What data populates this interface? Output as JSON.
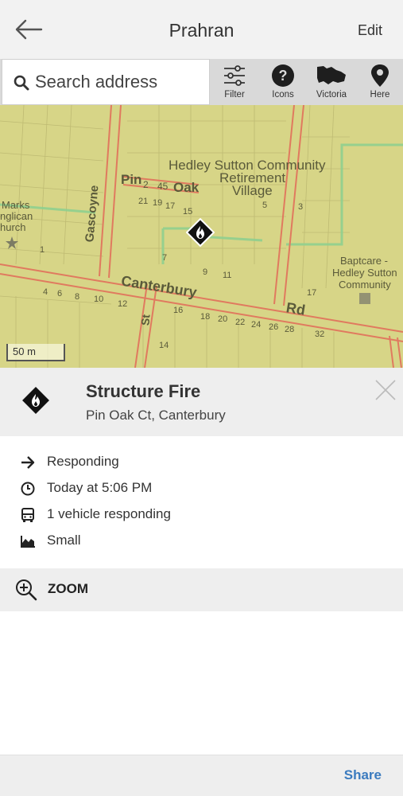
{
  "header": {
    "title": "Prahran",
    "edit_label": "Edit"
  },
  "search": {
    "placeholder": "Search address"
  },
  "toolbar": {
    "filter_label": "Filter",
    "icons_label": "Icons",
    "victoria_label": "Victoria",
    "here_label": "Here"
  },
  "map": {
    "labels": {
      "community": "Hedley Sutton Community",
      "retirement": "Retirement",
      "village": "Village",
      "pin": "Pin",
      "oak": "Oak",
      "gascoyne": "Gascoyne",
      "canterbury": "Canterbury",
      "rd": "Rd",
      "st": "St",
      "marks": "Marks",
      "anglican": "nglican",
      "church": "hurch",
      "baptcare": "Baptcare -",
      "hedley": "Hedley Sutton",
      "community2": "Community",
      "n2": "2",
      "n45": "45",
      "n21": "21",
      "n19": "19",
      "n17": "17",
      "n15": "15",
      "n9": "9",
      "n11": "11",
      "n16": "16",
      "n18": "18",
      "n20": "20",
      "n22": "22",
      "n24": "24",
      "n26": "26",
      "n28": "28",
      "n32": "32",
      "n4": "4",
      "n6": "6",
      "n8": "8",
      "n10": "10",
      "n12": "12",
      "n14": "14",
      "n1": "1",
      "n7": "7",
      "n3": "3",
      "n5": "5",
      "n17b": "17"
    },
    "scale_label": "50 m"
  },
  "incident": {
    "title": "Structure Fire",
    "location": "Pin Oak Ct, Canterbury"
  },
  "details": {
    "status": "Responding",
    "time": "Today at 5:06 PM",
    "vehicles": "1 vehicle responding",
    "size": "Small"
  },
  "zoom": {
    "label": "ZOOM"
  },
  "footer": {
    "share_label": "Share"
  },
  "colors": {
    "map_bg": "#d7d587",
    "road": "#e07a5f",
    "path": "#8fcf8f",
    "link": "#3b7bbf"
  },
  "icons": {
    "back": "arrow-left-icon",
    "search": "search-icon",
    "filter": "sliders-icon",
    "icons": "question-circle-icon",
    "victoria": "victoria-map-icon",
    "here": "location-pin-icon",
    "fire": "fire-diamond-icon",
    "close": "close-icon",
    "status": "arrow-right-icon",
    "time": "clock-icon",
    "vehicle": "bus-icon",
    "size": "area-chart-icon",
    "zoom": "zoom-in-icon"
  }
}
